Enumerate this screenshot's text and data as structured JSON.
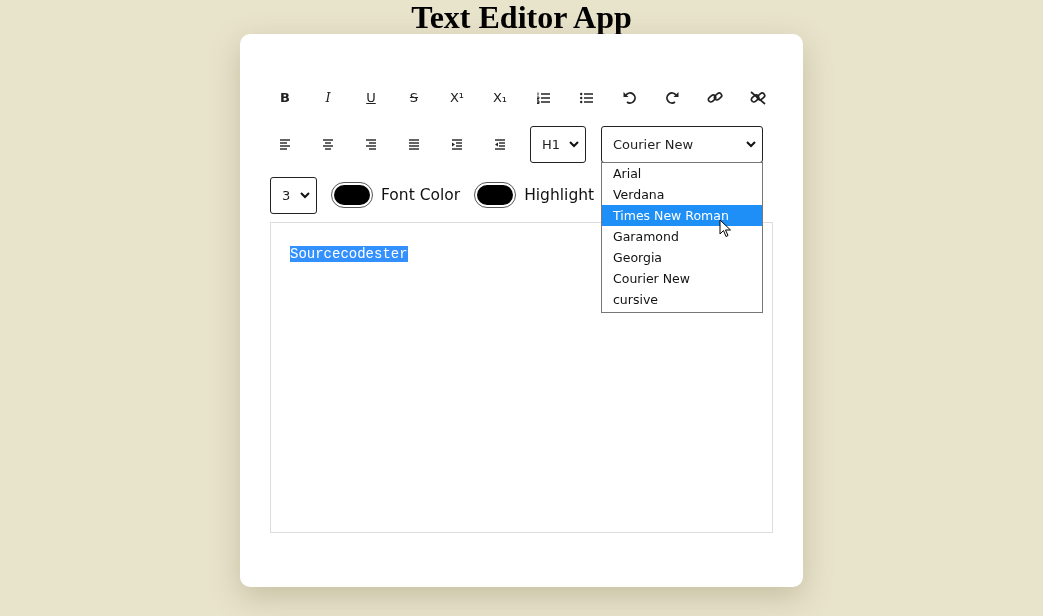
{
  "title": "Text Editor App",
  "toolbar_row_1": [
    {
      "kind": "bold",
      "label": "B"
    },
    {
      "kind": "italic",
      "label": "I"
    },
    {
      "kind": "underline",
      "label": "U"
    },
    {
      "kind": "strike",
      "label": "S"
    },
    {
      "kind": "sup",
      "label": "X¹"
    },
    {
      "kind": "sub",
      "label": "X₁"
    },
    {
      "kind": "ordered-list"
    },
    {
      "kind": "bullet-list"
    },
    {
      "kind": "undo"
    },
    {
      "kind": "redo"
    },
    {
      "kind": "link"
    },
    {
      "kind": "unlink"
    }
  ],
  "toolbar_row_2": [
    {
      "kind": "align-left"
    },
    {
      "kind": "align-center"
    },
    {
      "kind": "align-right"
    },
    {
      "kind": "justify"
    },
    {
      "kind": "indent"
    },
    {
      "kind": "outdent"
    }
  ],
  "heading_select": {
    "value": "H1"
  },
  "font_select": {
    "value": "Courier New",
    "expanded": true,
    "options": [
      {
        "label": "Arial",
        "highlighted": false
      },
      {
        "label": "Verdana",
        "highlighted": false
      },
      {
        "label": "Times New Roman",
        "highlighted": true
      },
      {
        "label": "Garamond",
        "highlighted": false
      },
      {
        "label": "Georgia",
        "highlighted": false
      },
      {
        "label": "Courier New",
        "highlighted": false
      },
      {
        "label": "cursive",
        "highlighted": false
      }
    ]
  },
  "size_select": {
    "value": "3"
  },
  "color_pickers": [
    {
      "label": "Font Color",
      "color": "#000000"
    },
    {
      "label": "Highlight",
      "color": "#000000"
    }
  ],
  "editor": {
    "text": "Sourcecodester",
    "selected": true
  }
}
